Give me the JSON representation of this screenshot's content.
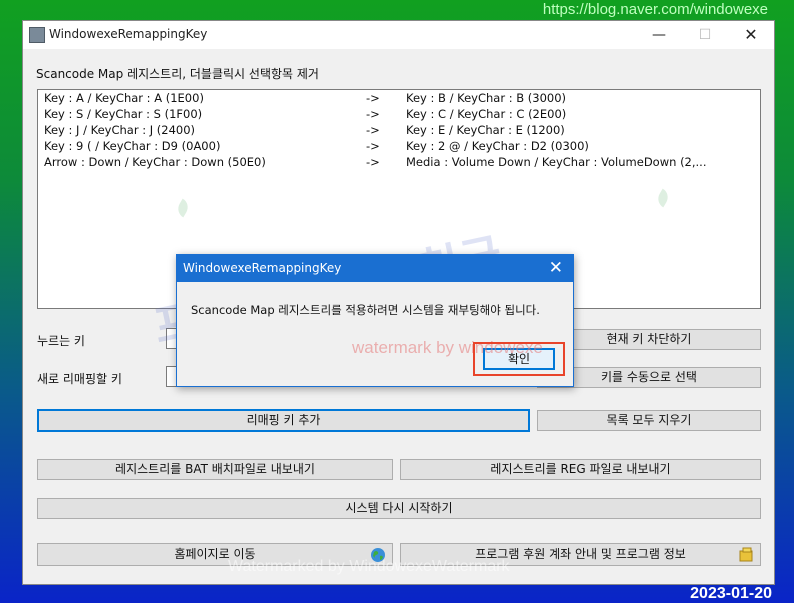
{
  "overlay": {
    "url": "https://blog.naver.com/windowexe",
    "date": "2023-01-20",
    "watermark_big": "프로세스 자료천국",
    "watermark_red": "watermark by windowexe",
    "watermark_bottom": "Watermarked by WindowexeWatermark"
  },
  "window": {
    "title": "WindowexeRemappingKey",
    "minimize": "—",
    "maximize": "☐",
    "close": "✕"
  },
  "list": {
    "header": "Scancode Map 레지스트리, 더블클릭시 선택항목 제거",
    "rows": [
      {
        "from": "Key : A / KeyChar : A (1E00)",
        "arrow": "->",
        "to": "Key : B / KeyChar : B (3000)"
      },
      {
        "from": "Key : S / KeyChar : S (1F00)",
        "arrow": "->",
        "to": "Key : C / KeyChar : C (2E00)"
      },
      {
        "from": "Key : J / KeyChar : J (2400)",
        "arrow": "->",
        "to": "Key : E / KeyChar : E (1200)"
      },
      {
        "from": "Key : 9 ( / KeyChar : D9 (0A00)",
        "arrow": "->",
        "to": "Key : 2 @ / KeyChar : D2 (0300)"
      },
      {
        "from": "Arrow : Down / KeyChar : Down (50E0)",
        "arrow": "->",
        "to": "Media : Volume Down / KeyChar : VolumeDown (2,..."
      }
    ]
  },
  "form": {
    "pressed_key_label": "누르는 키",
    "new_key_label": "새로 리매핑할 키",
    "block_current_key": "현재 키 차단하기",
    "select_key_manually": "키를 수동으로 선택",
    "add_remap": "리매핑 키 추가",
    "clear_all": "목록 모두 지우기",
    "export_bat": "레지스트리를 BAT 배치파일로 내보내기",
    "export_reg": "레지스트리를 REG 파일로 내보내기",
    "restart": "시스템 다시 시작하기",
    "homepage": "홈페이지로 이동",
    "about": "프로그램 후원 계좌 안내 및 프로그램 정보"
  },
  "dialog": {
    "title": "WindowexeRemappingKey",
    "close": "✕",
    "message": "Scancode Map 레지스트리를 적용하려면 시스템을 재부팅해야 됩니다.",
    "ok": "확인"
  }
}
